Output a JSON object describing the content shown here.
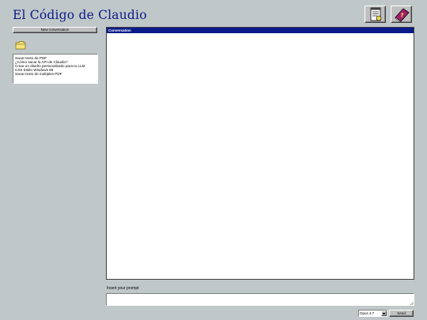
{
  "header": {
    "title": "El Código de Claudio",
    "notes_icon": "notepad-icon",
    "help_icon": "help-book-icon"
  },
  "sidebar": {
    "new_conversation_label": "New conversation",
    "folder_icon": "folder-icon",
    "history": [
      "Sacar texto de PDF",
      "¿Cómo sacar la API de Claudio?",
      "Crear un diseño personalizado para tu LLM",
      "CSS Estilo Windows 95",
      "Sacar texto de multiples PDF"
    ]
  },
  "conversation": {
    "header_label": "Conversation"
  },
  "prompt": {
    "label": "Insert your prompt",
    "value": ""
  },
  "footer": {
    "model_selected": "Opus 4.7",
    "send_label": "Send"
  },
  "colors": {
    "background": "#c0c7c8",
    "title": "#0a1a8a",
    "header_bar": "#0a1a8a",
    "book": "#a0206a"
  }
}
